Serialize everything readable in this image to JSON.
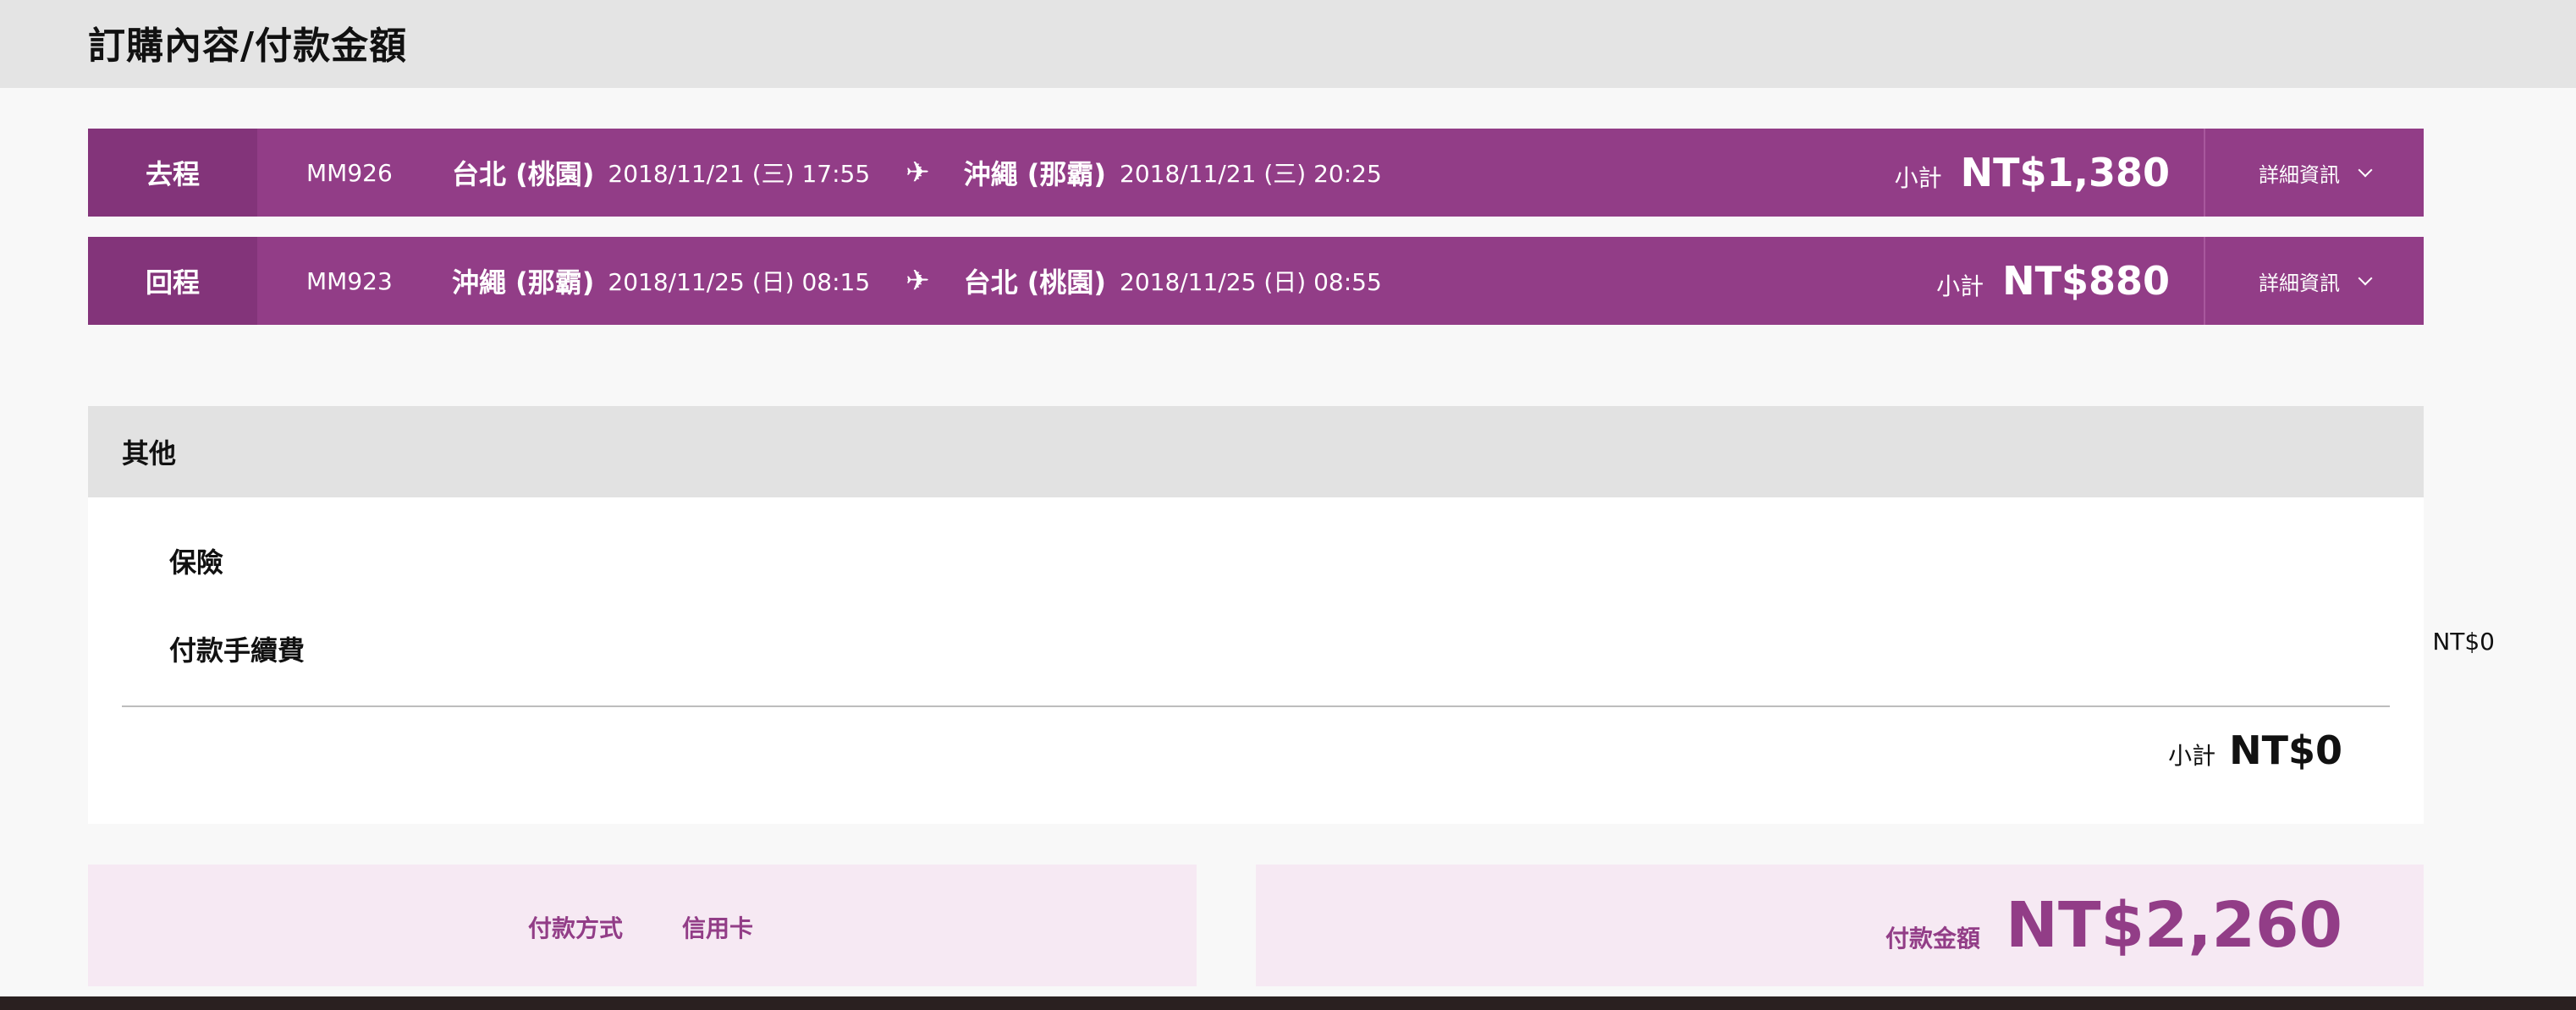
{
  "header": {
    "title": "訂購內容/付款金額"
  },
  "flights": [
    {
      "direction": "去程",
      "flight_no": "MM926",
      "from_city": "台北 (桃園)",
      "from_time": "2018/11/21 (三) 17:55",
      "to_city": "沖繩 (那霸)",
      "to_time": "2018/11/21 (三) 20:25",
      "subtotal_label": "小計",
      "subtotal": "NT$1,380",
      "detail_label": "詳細資訊"
    },
    {
      "direction": "回程",
      "flight_no": "MM923",
      "from_city": "沖繩 (那霸)",
      "from_time": "2018/11/25 (日) 08:15",
      "to_city": "台北 (桃園)",
      "to_time": "2018/11/25 (日) 08:55",
      "subtotal_label": "小計",
      "subtotal": "NT$880",
      "detail_label": "詳細資訊"
    }
  ],
  "other": {
    "title": "其他",
    "insurance_label": "保險",
    "fee_label": "付款手續費",
    "fee_value": "NT$0",
    "subtotal_label": "小計",
    "subtotal": "NT$0"
  },
  "payment": {
    "method_label": "付款方式",
    "method_value": "信用卡",
    "total_label": "付款金額",
    "total": "NT$2,260"
  },
  "colors": {
    "brand_purple": "#923d87",
    "brand_purple_dark": "#83347a",
    "pink_bg": "#f6e9f3"
  },
  "icons": [
    "plane-icon",
    "chevron-down-icon"
  ]
}
